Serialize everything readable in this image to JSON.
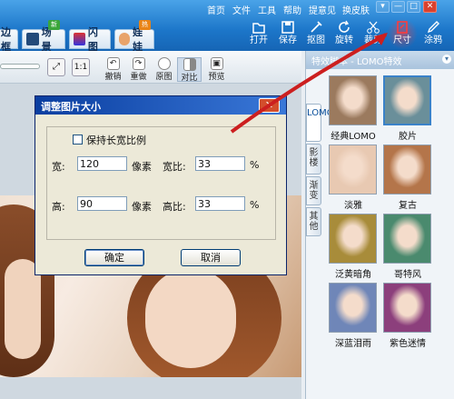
{
  "menu": [
    "首页",
    "文件",
    "工具",
    "帮助",
    "提意见",
    "换皮肤"
  ],
  "window_controls": [
    "▾",
    "—",
    "□",
    "✕"
  ],
  "tabs": [
    {
      "label": "边框"
    },
    {
      "label": "场景",
      "badge": "新"
    },
    {
      "label": "闪图"
    },
    {
      "label": "娃娃",
      "badge": "热"
    }
  ],
  "tools": [
    "打开",
    "保存",
    "抠图",
    "旋转",
    "裁剪",
    "尺寸",
    "涂鸦"
  ],
  "subtools": [
    "撤销",
    "重做",
    "原图",
    "对比",
    "预览"
  ],
  "right_panel": {
    "header": "特效脚本 - LOMO特效",
    "vtabs": [
      "LOMO",
      "影楼",
      "渐变",
      "其他"
    ],
    "effects": [
      {
        "label": "经典LOMO",
        "tint": "#9b7a5e"
      },
      {
        "label": "胶片",
        "tint": "#6a8f9a"
      },
      {
        "label": "淡雅",
        "tint": "#e8c9b2"
      },
      {
        "label": "复古",
        "tint": "#b4754a"
      },
      {
        "label": "泛黄暗角",
        "tint": "#a88c3a"
      },
      {
        "label": "哥特风",
        "tint": "#4a8a6e"
      },
      {
        "label": "深蓝泪雨",
        "tint": "#6f86b8"
      },
      {
        "label": "紫色迷情",
        "tint": "#8c3f7c"
      }
    ]
  },
  "dialog": {
    "title": "调整图片大小",
    "close": "✕",
    "keep_ratio_label": "保持长宽比例",
    "keep_ratio_checked": false,
    "width_label": "宽:",
    "width_value": "120",
    "width_unit": "像素",
    "height_label": "高:",
    "height_value": "90",
    "height_unit": "像素",
    "width_ratio_label": "宽比:",
    "width_ratio_value": "33",
    "width_ratio_unit": "%",
    "height_ratio_label": "高比:",
    "height_ratio_value": "33",
    "height_ratio_unit": "%",
    "ok": "确定",
    "cancel": "取消"
  },
  "colors": {
    "accent": "#1c76c9",
    "dialog_title": "#0a3ea0",
    "arrow": "#cc1f1f"
  }
}
